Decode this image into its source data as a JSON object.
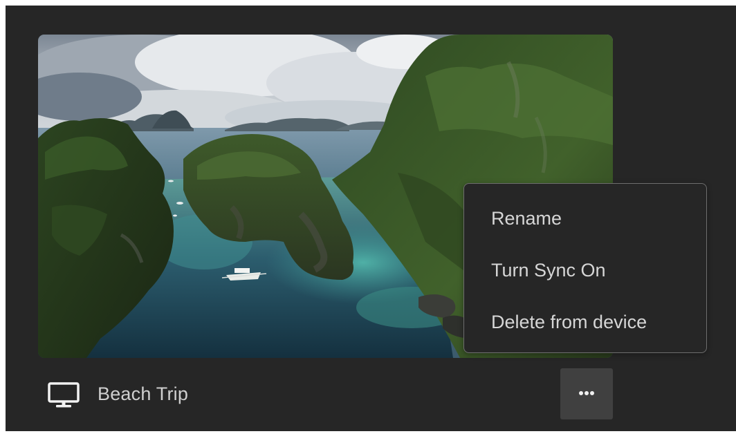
{
  "album": {
    "title": "Beach Trip",
    "location_icon": "desktop-computer-icon",
    "thumbnail_subject": "tropical lagoon between limestone islands"
  },
  "more_button": {
    "icon": "more-horizontal-icon"
  },
  "context_menu": {
    "items": [
      {
        "label": "Rename"
      },
      {
        "label": "Turn Sync On"
      },
      {
        "label": "Delete from device"
      }
    ]
  },
  "colors": {
    "background": "#262626",
    "menu_border": "#6e6e6e",
    "button_background": "#404040",
    "text": "#cfcfcf"
  }
}
